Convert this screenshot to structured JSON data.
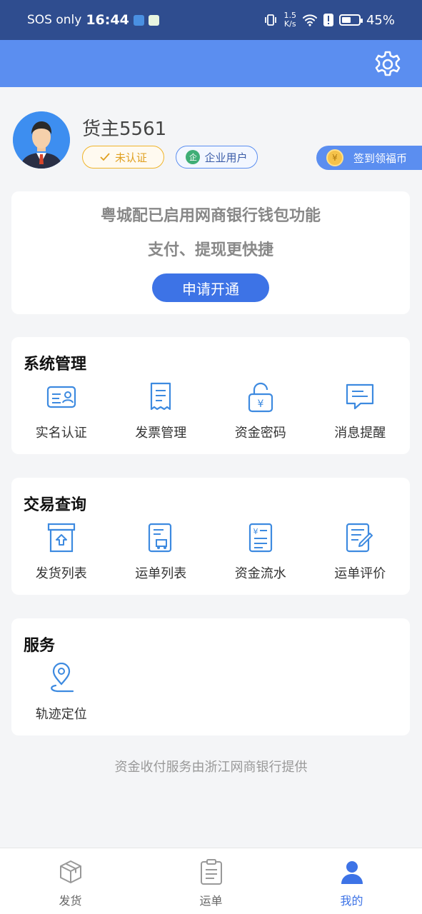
{
  "status_bar": {
    "carrier": "SOS only",
    "time": "16:44",
    "net_speed_value": "1.5",
    "net_speed_unit": "K/s",
    "battery_level": 0.45,
    "battery": "45%"
  },
  "header": {
    "settings_icon": "gear-icon"
  },
  "profile": {
    "username": "货主5561",
    "badge_unverified": "未认证",
    "badge_enterprise_icon": "企",
    "badge_enterprise": "企业用户",
    "checkin_icon": "¥",
    "checkin": "签到领福币"
  },
  "promo": {
    "line1": "粤城配已启用网商银行钱包功能",
    "line2": "支付、提现更快捷",
    "button": "申请开通"
  },
  "system": {
    "title": "系统管理",
    "items": [
      {
        "label": "实名认证",
        "icon": "id-card-icon"
      },
      {
        "label": "发票管理",
        "icon": "receipt-icon"
      },
      {
        "label": "资金密码",
        "icon": "lock-yuan-icon"
      },
      {
        "label": "消息提醒",
        "icon": "message-icon"
      }
    ]
  },
  "trade": {
    "title": "交易查询",
    "items": [
      {
        "label": "发货列表",
        "icon": "ship-box-icon"
      },
      {
        "label": "运单列表",
        "icon": "waybill-icon"
      },
      {
        "label": "资金流水",
        "icon": "ledger-icon"
      },
      {
        "label": "运单评价",
        "icon": "review-icon"
      }
    ]
  },
  "service": {
    "title": "服务",
    "items": [
      {
        "label": "轨迹定位",
        "icon": "location-pin-icon"
      }
    ]
  },
  "footer_note": "资金收付服务由浙江网商银行提供",
  "tabbar": {
    "tabs": [
      {
        "label": "发货",
        "icon": "box-icon",
        "active": false
      },
      {
        "label": "运单",
        "icon": "clipboard-icon",
        "active": false
      },
      {
        "label": "我的",
        "icon": "user-icon",
        "active": true
      }
    ]
  },
  "colors": {
    "status_bar": "#2f4d8f",
    "header": "#5b8ef0",
    "accent": "#3d73e6",
    "icon_line": "#3d8ae0"
  }
}
